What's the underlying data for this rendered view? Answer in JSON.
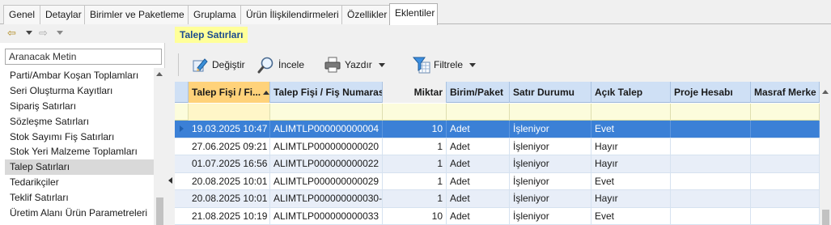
{
  "tabs": [
    {
      "label": "Genel",
      "active": false
    },
    {
      "label": "Detaylar",
      "active": false
    },
    {
      "label": "Birimler ve Paketleme",
      "active": false
    },
    {
      "label": "Gruplama",
      "active": false
    },
    {
      "label": "Ürün İlişkilendirmeleri",
      "active": false
    },
    {
      "label": "Özellikler",
      "active": false
    },
    {
      "label": "Eklentiler",
      "active": true
    }
  ],
  "sidebar": {
    "back_icon": "back-arrow-icon",
    "forward_icon": "forward-arrow-icon",
    "search_placeholder": "Aranacak Metin",
    "items": [
      {
        "label": "Parti/Ambar Koşan Toplamları",
        "selected": false
      },
      {
        "label": "Seri Oluşturma Kayıtları",
        "selected": false
      },
      {
        "label": "Sipariş Satırları",
        "selected": false
      },
      {
        "label": "Sözleşme Satırları",
        "selected": false
      },
      {
        "label": "Stok Sayımı Fiş Satırları",
        "selected": false
      },
      {
        "label": "Stok Yeri Malzeme Toplamları",
        "selected": false
      },
      {
        "label": "Talep Satırları",
        "selected": true
      },
      {
        "label": "Tedarikçiler",
        "selected": false
      },
      {
        "label": "Teklif Satırları",
        "selected": false
      },
      {
        "label": "Üretim Alanı Ürün Parametreleri",
        "selected": false
      }
    ]
  },
  "main": {
    "section_title": "Talep Satırları",
    "section_title_color": "#ffff99",
    "toolbar": {
      "change_label": "Değiştir",
      "inspect_label": "İncele",
      "print_label": "Yazdır",
      "filter_label": "Filtrele"
    },
    "columns": [
      "Talep Fişi / Fi...",
      "Talep Fişi / Fiş Numarası",
      "Miktar",
      "Birim/Paket",
      "Satır Durumu",
      "Açık Talep",
      "Proje Hesabı",
      "Masraf Merke"
    ],
    "rows": [
      {
        "date": "19.03.2025 10:47",
        "number": "ALIMTLP000000000004",
        "qty": "10",
        "unit": "Adet",
        "status": "İşleniyor",
        "open": "Evet",
        "project": "",
        "cost": "",
        "selected": true
      },
      {
        "date": "27.06.2025 09:21",
        "number": "ALIMTLP000000000020",
        "qty": "1",
        "unit": "Adet",
        "status": "İşleniyor",
        "open": "Hayır",
        "project": "",
        "cost": "",
        "selected": false
      },
      {
        "date": "01.07.2025 16:56",
        "number": "ALIMTLP000000000022",
        "qty": "1",
        "unit": "Adet",
        "status": "İşleniyor",
        "open": "Hayır",
        "project": "",
        "cost": "",
        "selected": false
      },
      {
        "date": "20.08.2025 10:01",
        "number": "ALIMTLP000000000029",
        "qty": "1",
        "unit": "Adet",
        "status": "İşleniyor",
        "open": "Evet",
        "project": "",
        "cost": "",
        "selected": false
      },
      {
        "date": "20.08.2025 10:01",
        "number": "ALIMTLP000000000030-...",
        "qty": "1",
        "unit": "Adet",
        "status": "İşleniyor",
        "open": "Hayır",
        "project": "",
        "cost": "",
        "selected": false
      },
      {
        "date": "21.08.2025 10:19",
        "number": "ALIMTLP000000000033",
        "qty": "10",
        "unit": "Adet",
        "status": "İşleniyor",
        "open": "Evet",
        "project": "",
        "cost": "",
        "selected": false
      }
    ],
    "selection_color": "#3b80d6",
    "sorted_header_color": "#ffd27a"
  }
}
